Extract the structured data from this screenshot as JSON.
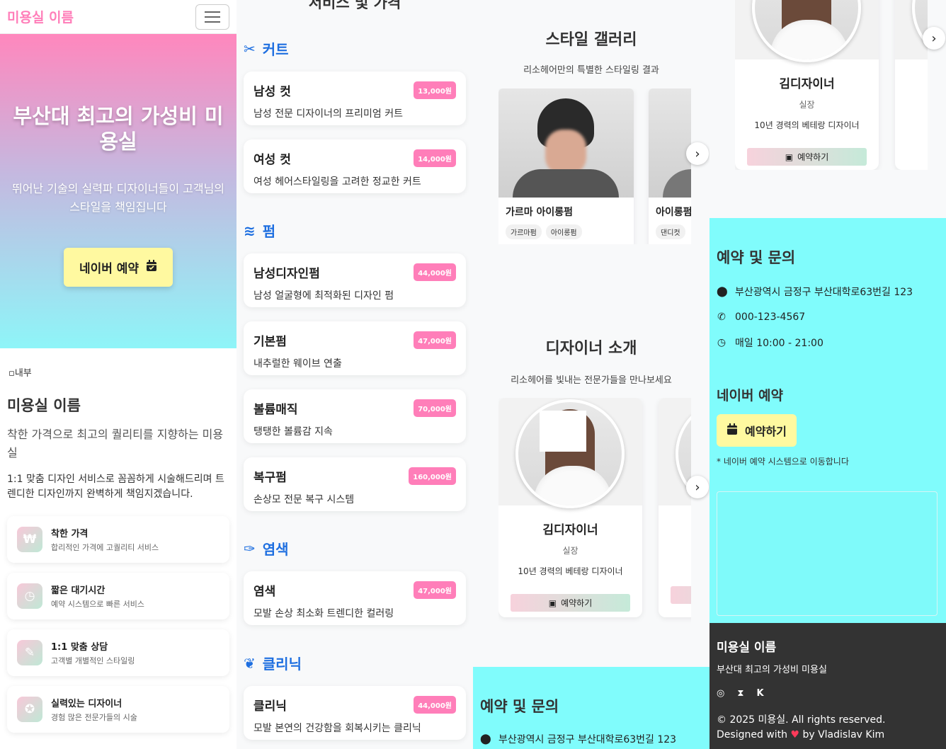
{
  "nav": {
    "brand": "미용실 이름"
  },
  "hero": {
    "title": "부산대 최고의 가성비 미용실",
    "subtitle": "뛰어난 기술의 실력파 디자이너들이 고객님의 스타일을 책임집니다",
    "cta": "네이버 예약"
  },
  "about": {
    "img_alt": "내부",
    "title": "미용실 이름",
    "lead": "착한 가격으로 최고의 퀄리티를 지향하는 미용실",
    "desc": "1:1 맞춤 디자인 서비스로 꼼꼼하게 시술해드리며 트렌디한 디자인까지 완벽하게 책임지겠습니다.",
    "features": [
      {
        "icon": "won-icon",
        "glyph": "₩",
        "title": "착한 가격",
        "sub": "합리적인 가격에 고퀄리티 서비스"
      },
      {
        "icon": "clock-icon",
        "glyph": "◷",
        "title": "짧은 대기시간",
        "sub": "예약 시스템으로 빠른 서비스"
      },
      {
        "icon": "user-edit-icon",
        "glyph": "✎",
        "title": "1:1 맞춤 상담",
        "sub": "고객별 개별적인 스타일링"
      },
      {
        "icon": "award-icon",
        "glyph": "✪",
        "title": "실력있는 디자이너",
        "sub": "경험 많은 전문가들의 시술"
      }
    ]
  },
  "services": {
    "title": "서비스 및 가격",
    "categories": [
      {
        "icon": "scissors-icon",
        "glyph": "✂",
        "label": "커트",
        "items": [
          {
            "name": "남성 컷",
            "desc": "남성 전문 디자이너의 프리미엄 커트",
            "price": "13,000원"
          },
          {
            "name": "여성 컷",
            "desc": "여성 헤어스타일링을 고려한 정교한 커트",
            "price": "14,000원"
          }
        ]
      },
      {
        "icon": "water-icon",
        "glyph": "≋",
        "label": "펌",
        "items": [
          {
            "name": "남성디자인펌",
            "desc": "남성 얼굴형에 최적화된 디자인 펌",
            "price": "44,000원"
          },
          {
            "name": "기본펌",
            "desc": "내추럴한 웨이브 연출",
            "price": "47,000원"
          },
          {
            "name": "볼륨매직",
            "desc": "탱탱한 볼륨감 지속",
            "price": "70,000원"
          },
          {
            "name": "복구펌",
            "desc": "손상모 전문 복구 시스템",
            "price": "160,000원"
          }
        ]
      },
      {
        "icon": "brush-icon",
        "glyph": "✑",
        "label": "염색",
        "items": [
          {
            "name": "염색",
            "desc": "모발 손상 최소화 트렌디한 컬러링",
            "price": "47,000원"
          }
        ]
      },
      {
        "icon": "spa-icon",
        "glyph": "❦",
        "label": "클리닉",
        "items": [
          {
            "name": "클리닉",
            "desc": "모발 본연의 건강함을 회복시키는 클리닉",
            "price": "44,000원"
          }
        ]
      }
    ]
  },
  "gallery": {
    "title": "스타일 갤러리",
    "subtitle": "리소헤어만의 특별한 스타일링 결과",
    "items": [
      {
        "name": "가르마 아이롱펌",
        "tags": [
          "가르마펌",
          "아이롱펌"
        ]
      },
      {
        "name": "아이롱펌",
        "tags": [
          "댄디컷"
        ]
      }
    ]
  },
  "designers": {
    "title": "디자이너 소개",
    "subtitle": "리소헤어를 빛내는 전문가들을 만나보세요",
    "items": [
      {
        "name": "김디자이너",
        "role": "실장",
        "exp": "10년 경력의 베테랑 디자이너",
        "btn": "예약하기"
      }
    ]
  },
  "contact": {
    "title": "예약 및 문의",
    "address": "부산광역시 금정구 부산대학로63번길 123",
    "phone": "000-123-4567",
    "hours": "매일 10:00 - 21:00",
    "naver_title": "네이버 예약",
    "naver_btn": "예약하기",
    "naver_note": "* 네이버 예약 시스템으로 이동합니다"
  },
  "footer": {
    "title": "미용실 이름",
    "subtitle": "부산대 최고의 가성비 미용실",
    "socials": [
      "instagram-icon",
      "hourglass-icon",
      "kakao-icon"
    ],
    "copyright": "© 2025 미용실. All rights reserved.",
    "designed_pre": "Designed with",
    "designed_post": "by Vladislav Kim"
  },
  "colors": {
    "brand": "#ff7eb9",
    "accent_blue": "#1e6fe0",
    "cyan": "#80fcfc",
    "cta_yellow": "#fff9a0",
    "footer_bg": "#333333"
  }
}
